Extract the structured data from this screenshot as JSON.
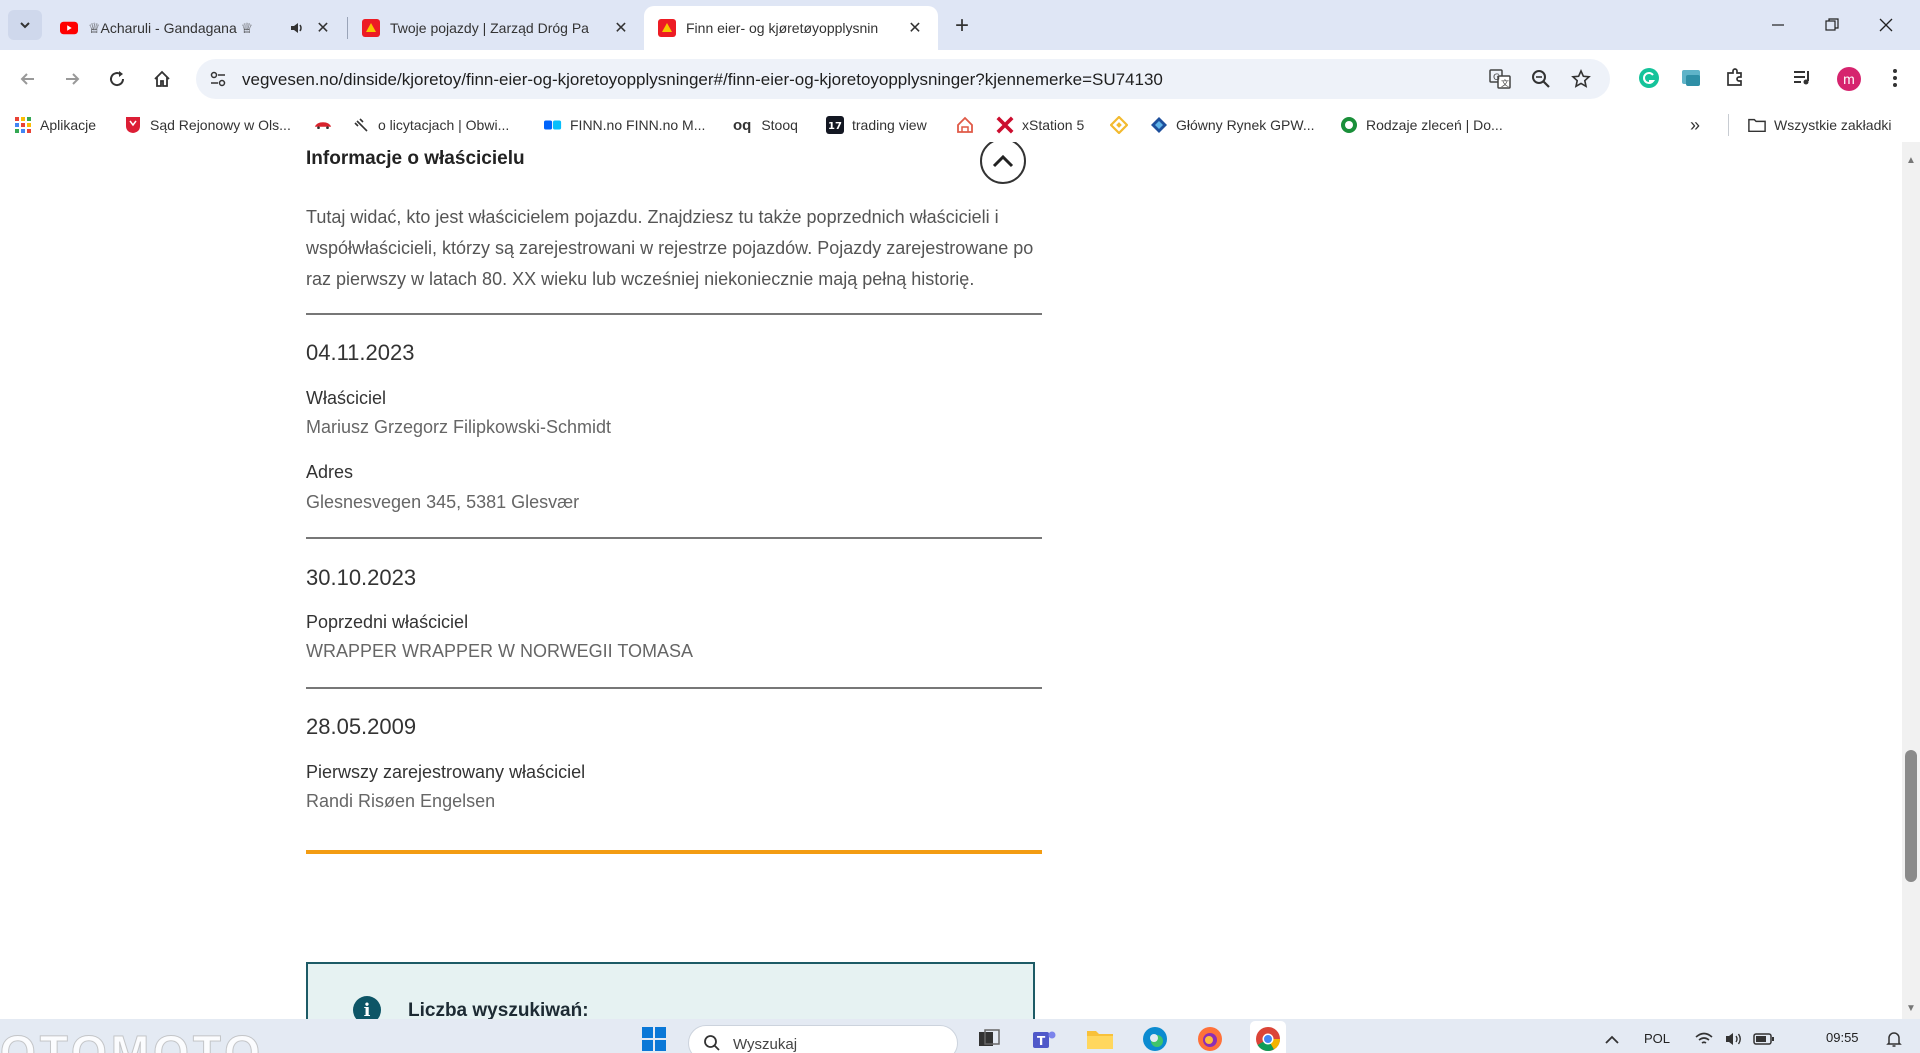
{
  "browser": {
    "tabs": [
      {
        "title": "♕Acharuli - Gandagana ♕",
        "icon": "youtube-icon",
        "muted_icon": "speaker-icon"
      },
      {
        "title": "Twoje pojazdy | Zarząd Dróg Pa",
        "icon": "statens-vegvesen-icon"
      },
      {
        "title": "Finn eier- og kjøretøyopplysnin",
        "icon": "statens-vegvesen-icon",
        "active": true
      }
    ],
    "url": "vegvesen.no/dinside/kjoretoy/finn-eier-og-kjoretoyopplysninger#/finn-eier-og-kjoretoyopplysninger?kjennemerke=SU74130",
    "profile_initial": "m",
    "accent_color": "#d6246e"
  },
  "bookmarks": {
    "items": [
      {
        "label": "Aplikacje"
      },
      {
        "label": "Sąd Rejonowy w Ols..."
      },
      {
        "label": ""
      },
      {
        "label": "o licytacjach | Obwi..."
      },
      {
        "label": "FINN.no FINN.no M..."
      },
      {
        "label": "Stooq"
      },
      {
        "label": "trading view"
      },
      {
        "label": ""
      },
      {
        "label": "xStation 5"
      },
      {
        "label": ""
      },
      {
        "label": "Główny Rynek GPW..."
      },
      {
        "label": "Rodzaje zleceń | Do..."
      }
    ],
    "more": "»",
    "all_bookmarks": "Wszystkie zakładki"
  },
  "page": {
    "section_title": "Informacje o właścicielu",
    "intro": "Tutaj widać, kto jest właścicielem pojazdu. Znajdziesz tu także poprzednich właścicieli i współwłaścicieli, którzy są zarejestrowani w rejestrze pojazdów. Pojazdy zarejestrowane po raz pierwszy w latach 80. XX wieku lub wcześniej niekoniecznie mają pełną historię.",
    "entries": [
      {
        "date": "04.11.2023",
        "role_label": "Właściciel",
        "name": "Mariusz Grzegorz Filipkowski-Schmidt",
        "address_label": "Adres",
        "address": "Glesnesvegen 345, 5381 Glesvær"
      },
      {
        "date": "30.10.2023",
        "role_label": "Poprzedni właściciel",
        "name": "WRAPPER WRAPPER W NORWEGII TOMASA"
      },
      {
        "date": "28.05.2009",
        "role_label": "Pierwszy zarejestrowany właściciel",
        "name": "Randi Risøen Engelsen"
      }
    ],
    "info_box_label": "Liczba wyszukiwań:",
    "divider_color": "#f39c12"
  },
  "taskbar": {
    "watermark": "OTOMOTO",
    "search_placeholder": "Wyszukaj",
    "language": "POL",
    "time": "09:55"
  }
}
